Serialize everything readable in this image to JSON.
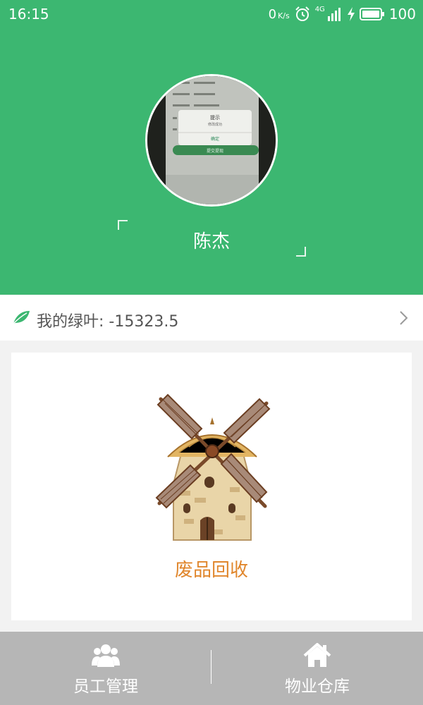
{
  "status_bar": {
    "time": "16:15",
    "net_speed": "0",
    "net_unit": "K/s",
    "network_type": "4G",
    "battery_level": "100",
    "icons": [
      "alarm-icon",
      "signal-icon",
      "charging-icon",
      "battery-icon"
    ]
  },
  "profile": {
    "user_name": "陈杰",
    "avatar_icon": "profile-photo",
    "avatar_screen": {
      "dialog_title": "提示",
      "dialog_message": "修改成功",
      "dialog_confirm": "确定",
      "submit_button": "提交提现"
    }
  },
  "green_leaf": {
    "label": "我的绿叶:",
    "value": "-15323.5",
    "icon": "leaf-icon",
    "chevron": "chevron-right-icon"
  },
  "feature_card": {
    "label": "废品回收",
    "icon": "windmill-icon"
  },
  "tabbar": {
    "tabs": [
      {
        "label": "员工管理",
        "icon": "users-icon"
      },
      {
        "label": "物业仓库",
        "icon": "home-icon"
      }
    ]
  },
  "colors": {
    "primary_green": "#3cb771",
    "accent_orange": "#e0862c",
    "tabbar_gray": "#b6b6b6",
    "page_background": "#f2f2f2"
  }
}
